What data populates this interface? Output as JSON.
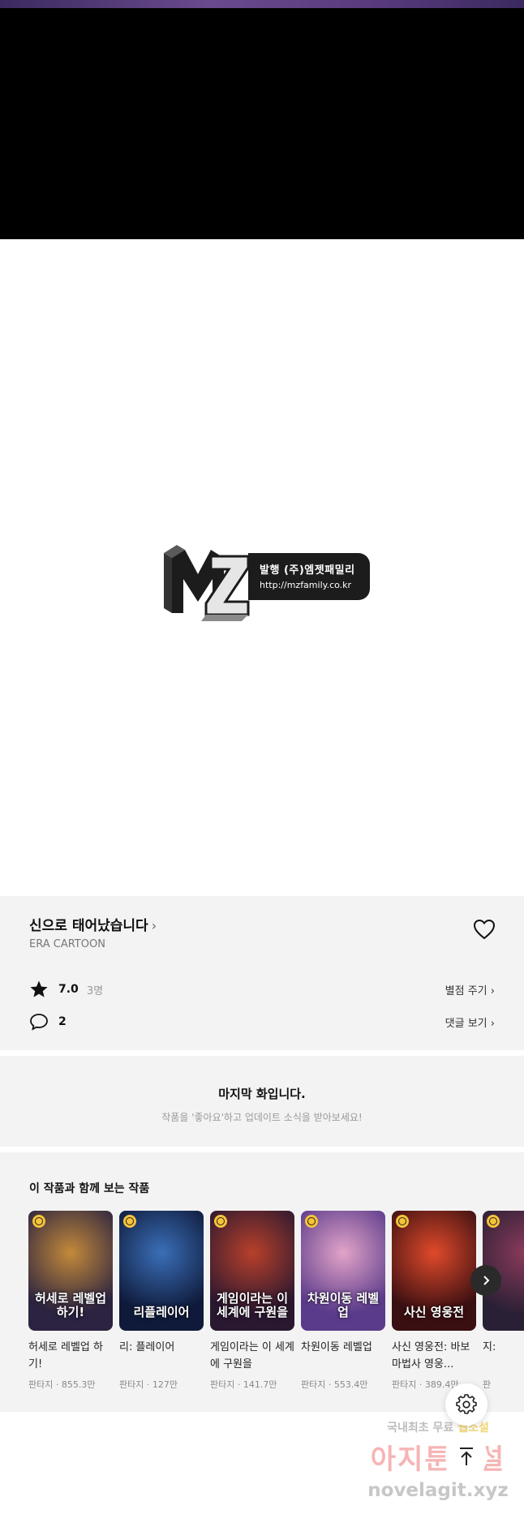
{
  "viewer": {
    "logo": {
      "mark": "MZ",
      "publisher": "발행 (주)엠젯패밀리",
      "url": "http://mzfamily.co.kr"
    }
  },
  "series": {
    "title": "신으로 태어났습니다",
    "author": "ERA CARTOON",
    "rating": "7.0",
    "rating_count": "3명",
    "rate_link": "별점 주기",
    "comment_count": "2",
    "comment_link": "댓글 보기"
  },
  "last_episode": {
    "title": "마지막 화입니다.",
    "subtitle": "작품을 '좋아요'하고 업데이트 소식을 받아보세요!"
  },
  "recommendations": {
    "heading": "이 작품과 함께 보는 작품",
    "items": [
      {
        "title": "허세로 레벨업 하기!",
        "genre": "판타지",
        "views": "855.3만",
        "cover_text": "허세로 레벨업 하기!",
        "color_a": "#2b2340",
        "color_b": "#c48a3a"
      },
      {
        "title": "리: 플레이어",
        "genre": "판타지",
        "views": "127만",
        "cover_text": "리플레이어",
        "color_a": "#0f1a3a",
        "color_b": "#3a6fb8"
      },
      {
        "title": "게임이라는 이 세계에 구원을",
        "genre": "판타지",
        "views": "141.7만",
        "cover_text": "게임이라는 이 세계에 구원을",
        "color_a": "#2a1830",
        "color_b": "#b8402a"
      },
      {
        "title": "차원이동 레벨업",
        "genre": "판타지",
        "views": "553.4만",
        "cover_text": "차원이동 레벨업",
        "color_a": "#5a3a8a",
        "color_b": "#e2a4c8"
      },
      {
        "title": "사신 영웅전: 바보 마법사 영웅...",
        "genre": "판타지",
        "views": "389.4만",
        "cover_text": "사신 영웅전",
        "color_a": "#3a0f12",
        "color_b": "#e04a2a"
      },
      {
        "title": "지:",
        "genre": "판",
        "views": "",
        "cover_text": "",
        "color_a": "#2a2035",
        "color_b": "#8a3a5a"
      }
    ]
  },
  "watermark": {
    "line1_a": "국내최초 무료 ",
    "line1_b": "웹소설",
    "line2": "아지툰소설",
    "line3": "novelagit.xyz"
  }
}
